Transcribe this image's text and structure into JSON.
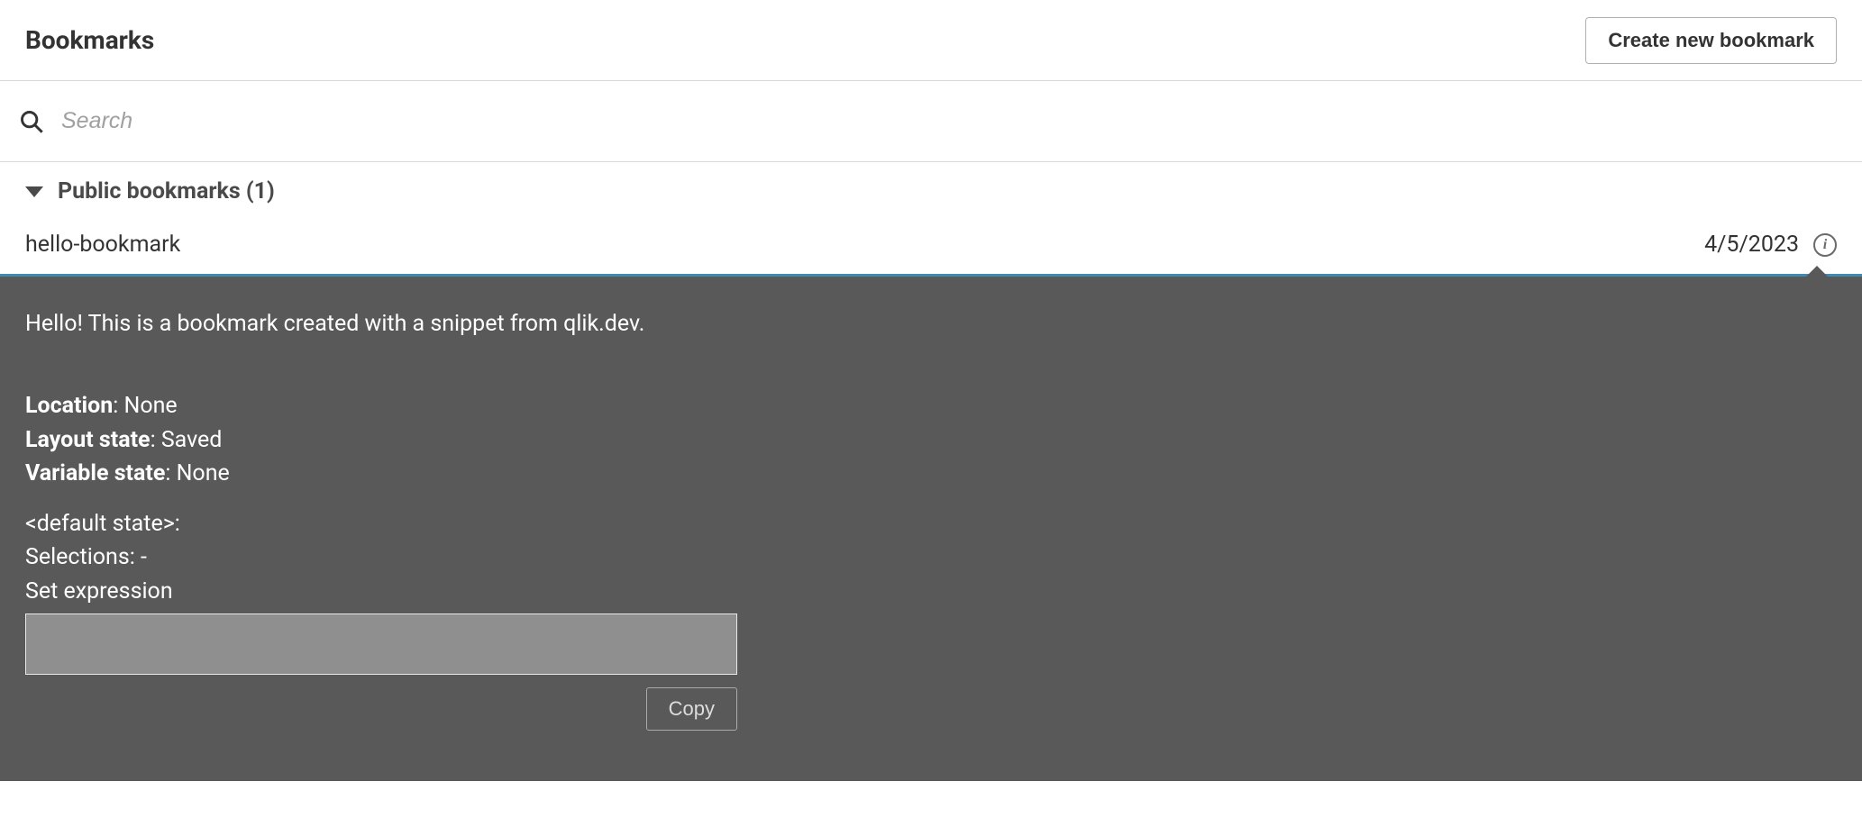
{
  "header": {
    "title": "Bookmarks",
    "create_label": "Create new bookmark"
  },
  "search": {
    "placeholder": "Search",
    "value": ""
  },
  "section": {
    "title": "Public bookmarks (1)"
  },
  "bookmark": {
    "name": "hello-bookmark",
    "date": "4/5/2023"
  },
  "detail": {
    "description": "Hello! This is a bookmark created with a snippet from qlik.dev.",
    "location_label": "Location",
    "location_value": ": None",
    "layout_label": "Layout state",
    "layout_value": ": Saved",
    "variable_label": "Variable state",
    "variable_value": ": None",
    "default_state_label": "<default state>",
    "default_state_colon": ":",
    "selections_text": "Selections: -",
    "set_expression_label": "Set expression",
    "expression_value": "",
    "copy_label": "Copy"
  }
}
